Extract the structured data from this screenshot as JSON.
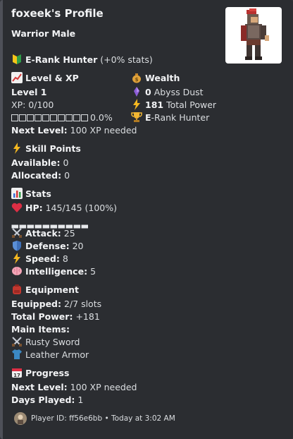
{
  "profile": {
    "title": "foxeek's Profile",
    "subtitle": "Warrior Male",
    "rank_label": "E-Rank Hunter",
    "rank_bonus": "(+0% stats)"
  },
  "level": {
    "header": "Level & XP",
    "level_text": "Level 1",
    "xp_text": "XP: 0/100",
    "xp_bar_text": "□□□□□□□□□□",
    "xp_percent": "0.0%",
    "progress_fraction": 0.0,
    "next_label": "Next Level:",
    "next_value": "100 XP needed"
  },
  "wealth": {
    "header": "Wealth",
    "dust_value": "0",
    "dust_label": "Abyss Dust",
    "power_value": "181",
    "power_label": "Total Power",
    "rank_letter": "E",
    "rank_rest": "-Rank Hunter"
  },
  "skill_points": {
    "header": "Skill Points",
    "available_label": "Available:",
    "available_value": "0",
    "allocated_label": "Allocated:",
    "allocated_value": "0"
  },
  "stats": {
    "header": "Stats",
    "hp_label": "HP:",
    "hp_value": "145/145 (100%)",
    "hp_bar_text": "▰▰▰▰▰▰▰▰▰▰",
    "hp_fraction": 1.0,
    "attack_label": "Attack:",
    "attack_value": "25",
    "defense_label": "Defense:",
    "defense_value": "20",
    "speed_label": "Speed:",
    "speed_value": "8",
    "intelligence_label": "Intelligence:",
    "intelligence_value": "5"
  },
  "equipment": {
    "header": "Equipment",
    "equipped_label": "Equipped:",
    "equipped_value": "2/7 slots",
    "power_label": "Total Power:",
    "power_value": "+181",
    "main_items_label": "Main Items:",
    "items": [
      "Rusty Sword",
      "Leather Armor"
    ]
  },
  "progress": {
    "header": "Progress",
    "next_label": "Next Level:",
    "next_value": "100 XP needed",
    "days_label": "Days Played:",
    "days_value": "1"
  },
  "footer": {
    "text": "Player ID: ff56e6bb • Today at 3:02 AM"
  },
  "icons": {
    "rank": "beginner-badge-icon",
    "level": "chart-increasing-icon",
    "wealth": "money-bag-icon",
    "dust": "purple-crystal-icon",
    "power": "lightning-icon",
    "trophy": "trophy-icon",
    "skill": "lightning-icon",
    "stats": "bar-chart-icon",
    "hp": "heart-icon",
    "attack": "crossed-swords-icon",
    "defense": "shield-icon",
    "speed": "lightning-icon",
    "intelligence": "brain-icon",
    "equipment": "backpack-icon",
    "sword": "crossed-swords-icon",
    "armor": "shirt-icon",
    "progress": "calendar-icon"
  },
  "colors": {
    "background": "#2b2d31",
    "accent_border": "#4e5058",
    "text": "#dbdee1",
    "heading": "#f2f3f5"
  }
}
